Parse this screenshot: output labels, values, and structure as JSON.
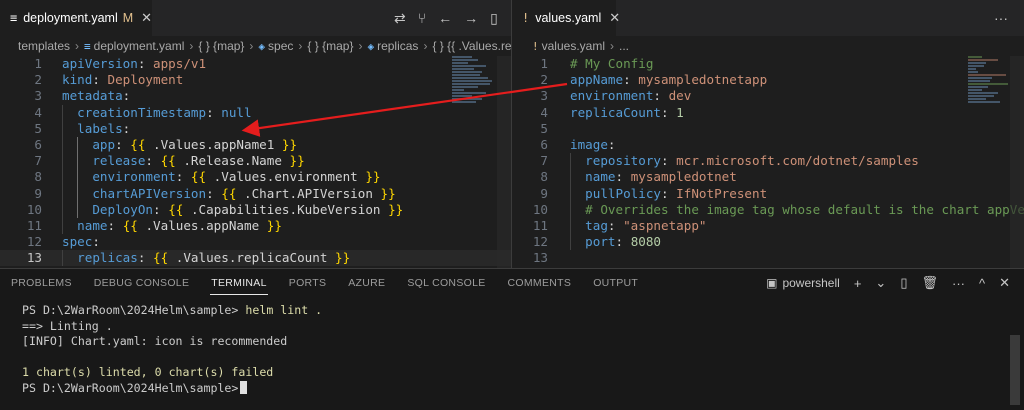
{
  "left_editor": {
    "tab": {
      "icon": "≡",
      "title": "deployment.yaml",
      "modified": "M",
      "close": "✕"
    },
    "breadcrumb": [
      "templates",
      "deployment.yaml",
      "{ } {map}",
      "spec",
      "{ } {map}",
      "replicas",
      "{ } {{ .Values.rep"
    ]
  },
  "right_editor": {
    "tab": {
      "icon": "!",
      "title": "values.yaml",
      "close": "✕"
    },
    "breadcrumb": [
      "values.yaml",
      "..."
    ]
  },
  "icons": {
    "compare": "⇄",
    "source_control": "⑂",
    "go_back": "←",
    "go_forward": "→",
    "split": "▯",
    "more_left": "···",
    "more_right": "···",
    "terminal_shell": "▣",
    "add": "+",
    "dropdown": "⌄",
    "split_terminal": "▯",
    "trash": "🗑",
    "more": "···",
    "maximize": "^",
    "close": "✕"
  },
  "panel": {
    "tabs": [
      "PROBLEMS",
      "DEBUG CONSOLE",
      "TERMINAL",
      "PORTS",
      "AZURE",
      "SQL CONSOLE",
      "COMMENTS",
      "OUTPUT"
    ],
    "active_tab": "TERMINAL",
    "shell": "powershell",
    "terminal": {
      "prompt": "PS D:\\2WarRoom\\2024Helm\\sample>",
      "command": "helm lint .",
      "line2": "==> Linting .",
      "line3": "[INFO] Chart.yaml: icon is recommended",
      "line5": "1 chart(s) linted, 0 chart(s) failed",
      "prompt2": "PS D:\\2WarRoom\\2024Helm\\sample>"
    }
  },
  "colors": {
    "annotation_arrow": "#e51d1d",
    "key": "#569cd6",
    "string": "#ce9178",
    "comment": "#6a9955",
    "number": "#b5cea8"
  }
}
